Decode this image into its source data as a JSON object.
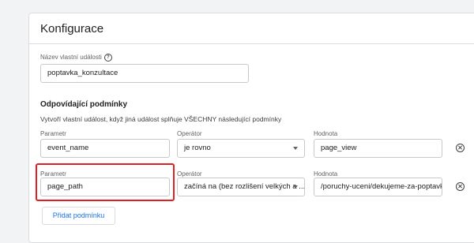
{
  "card": {
    "title": "Konfigurace"
  },
  "event_name": {
    "label": "Název vlastní události",
    "value": "poptavka_konzultace"
  },
  "conditions": {
    "title": "Odpovídající podmínky",
    "description": "Vytvoří vlastní událost, když jiná událost splňuje VŠECHNY následující podmínky",
    "rows": [
      {
        "param_label": "Parametr",
        "param_value": "event_name",
        "operator_label": "Operátor",
        "operator_value": "je rovno",
        "value_label": "Hodnota",
        "value_value": "page_view"
      },
      {
        "param_label": "Parametr",
        "param_value": "page_path",
        "operator_label": "Operátor",
        "operator_value": "začíná na (bez rozlišení velkých a ...",
        "value_label": "Hodnota",
        "value_value": "/poruchy-uceni/dekujeme-za-poptavku"
      }
    ],
    "add_label": "Přidat podmínku"
  },
  "icons": {
    "help": "help-circle-icon",
    "remove": "remove-circle-icon",
    "dropdown": "chevron-down-icon"
  },
  "colors": {
    "highlight": "#e02020",
    "accent": "#1a73e8"
  }
}
